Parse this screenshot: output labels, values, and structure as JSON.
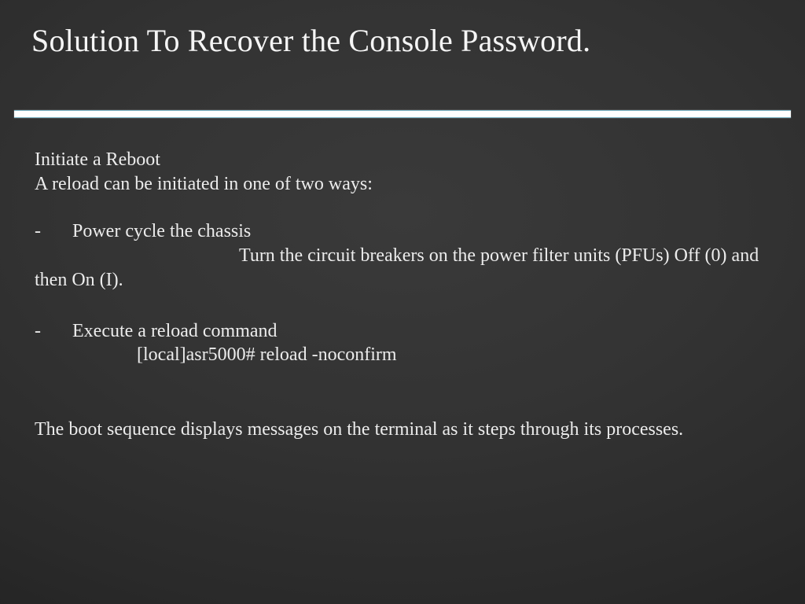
{
  "title": "Solution To Recover the Console Password.",
  "body": {
    "line1": "Initiate a Reboot",
    "line2": "A reload can be initiated in one of two ways:",
    "opt1_label": "Power cycle the chassis",
    "opt1_detail": "Turn the circuit breakers on the power filter units (PFUs) Off (0) and then On (I).",
    "opt2_label": "Execute a reload command",
    "opt2_detail": "[local]asr5000# reload -noconfirm",
    "footer": "The boot sequence displays messages on the terminal as it steps through its processes.",
    "dash": "-"
  }
}
